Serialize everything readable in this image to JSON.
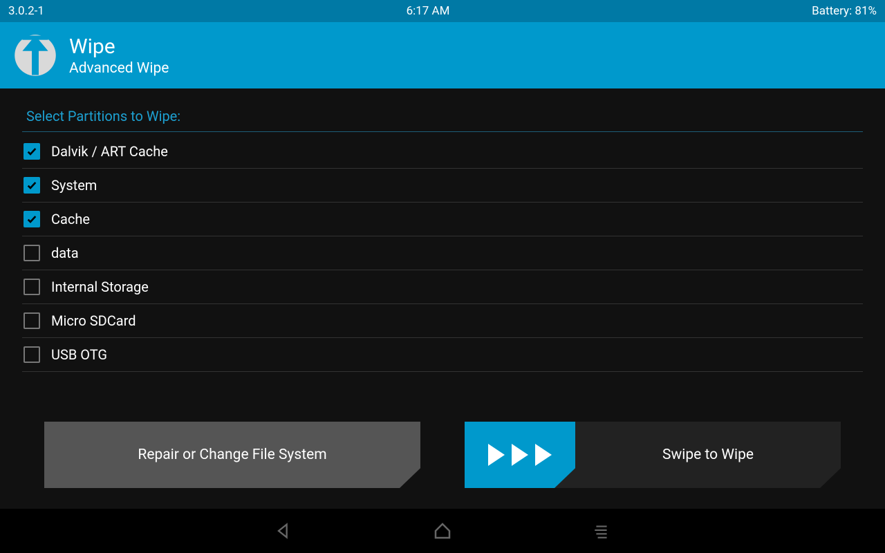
{
  "statusbar": {
    "version": "3.0.2-1",
    "time": "6:17 AM",
    "battery": "Battery: 81%"
  },
  "header": {
    "title": "Wipe",
    "subtitle": "Advanced Wipe"
  },
  "section_label": "Select Partitions to Wipe:",
  "partitions": [
    {
      "label": "Dalvik / ART Cache",
      "checked": true
    },
    {
      "label": "System",
      "checked": true
    },
    {
      "label": "Cache",
      "checked": true
    },
    {
      "label": "data",
      "checked": false
    },
    {
      "label": "Internal Storage",
      "checked": false
    },
    {
      "label": "Micro SDCard",
      "checked": false
    },
    {
      "label": "USB OTG",
      "checked": false
    }
  ],
  "buttons": {
    "repair": "Repair or Change File System",
    "swipe": "Swipe to Wipe"
  }
}
